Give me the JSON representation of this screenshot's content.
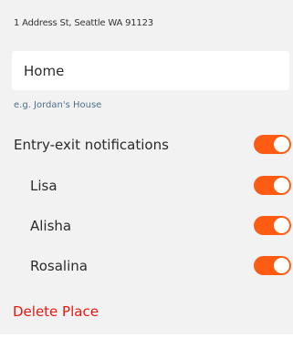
{
  "place": {
    "address": "1 Address St, Seattle WA 91123",
    "name_value": "Home",
    "name_hint": "e.g. Jordan's House"
  },
  "notifications": {
    "main_label": "Entry-exit notifications",
    "main_enabled": true,
    "members": [
      {
        "name": "Lisa",
        "enabled": true
      },
      {
        "name": "Alisha",
        "enabled": true
      },
      {
        "name": "Rosalina",
        "enabled": true
      }
    ]
  },
  "actions": {
    "delete_label": "Delete Place"
  },
  "colors": {
    "toggle_on": "#ff5c13",
    "delete": "#e8170f",
    "hint": "#4f6f8b",
    "background": "#f2f2f2"
  }
}
